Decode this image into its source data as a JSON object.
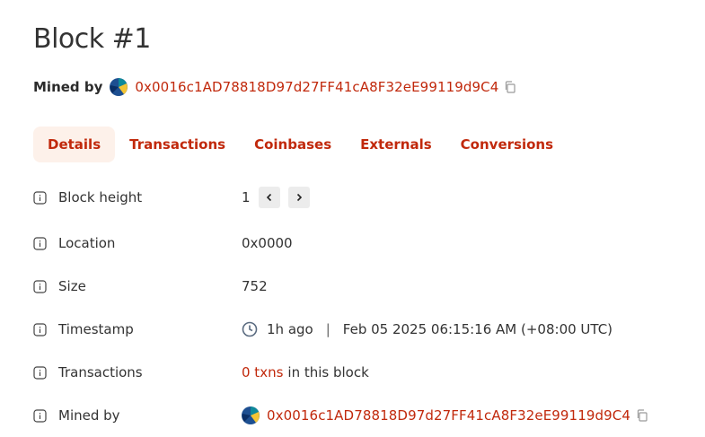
{
  "page": {
    "title": "Block #1"
  },
  "header": {
    "mined_by_label": "Mined by",
    "miner_address": "0x0016c1AD78818D97d27FF41cA8F32eE99119d9C4"
  },
  "tabs": [
    {
      "label": "Details",
      "active": true
    },
    {
      "label": "Transactions",
      "active": false
    },
    {
      "label": "Coinbases",
      "active": false
    },
    {
      "label": "Externals",
      "active": false
    },
    {
      "label": "Conversions",
      "active": false
    }
  ],
  "details": {
    "block_height": {
      "label": "Block height",
      "value": "1"
    },
    "location": {
      "label": "Location",
      "value": "0x0000"
    },
    "size": {
      "label": "Size",
      "value": "752"
    },
    "timestamp": {
      "label": "Timestamp",
      "relative": "1h ago",
      "separator": "|",
      "absolute": "Feb 05 2025 06:15:16 AM (+08:00 UTC)"
    },
    "transactions": {
      "label": "Transactions",
      "count_link": "0 txns",
      "suffix": "in this block"
    },
    "mined_by": {
      "label": "Mined by",
      "value": "0x0016c1AD78818D97d27FF41cA8F32eE99119d9C4"
    }
  },
  "colors": {
    "accent": "#c1290c",
    "active_tab_bg": "#fdf1ea",
    "nav_button_bg": "#ececec"
  },
  "icons": [
    "copy-icon",
    "info-icon",
    "chevron-left-icon",
    "chevron-right-icon",
    "clock-icon",
    "avatar-identicon"
  ]
}
